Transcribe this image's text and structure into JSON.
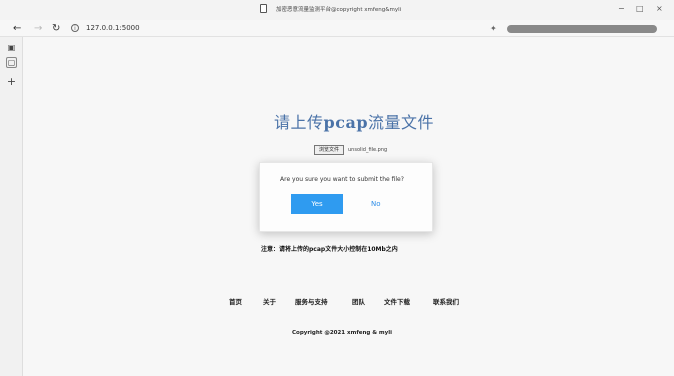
{
  "browser": {
    "title": "加密恶意流量监测平台@copyright xmfeng&myli",
    "url": "127.0.0.1:5000",
    "controls": {
      "minimize": "−",
      "maximize": "□",
      "close": "×"
    }
  },
  "page": {
    "heading_prefix": "请上传",
    "heading_keyword": "pcap",
    "heading_suffix": "流量文件",
    "file_button": "浏览文件",
    "file_name": "unsolid_file.png",
    "notice": "注意：请将上传的pcap文件大小控制在10Mb之内",
    "dialog": {
      "message": "Are you sure you want to submit the file?",
      "yes": "Yes",
      "no": "No"
    },
    "footer_links": [
      "首页",
      "关于",
      "服务与支持",
      "团队",
      "文件下载",
      "联系我们"
    ],
    "copyright": "Copyright @2021 xmfeng & myli"
  }
}
